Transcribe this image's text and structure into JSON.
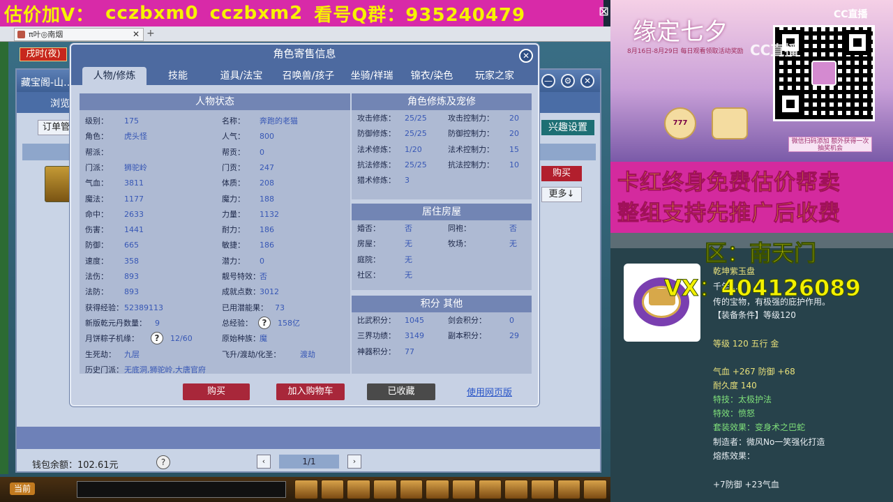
{
  "banner": {
    "segments": [
      "估价加V：",
      "cczbxm0",
      "cczbxm2",
      "看号Q群：935240479"
    ]
  },
  "browser": {
    "tab_title": "π叶◎南烟",
    "close": "✕",
    "new_tab": "+"
  },
  "hud": {
    "time": "戌时(夜)"
  },
  "store": {
    "title": "藏宝阁-山…",
    "browse": "浏览",
    "order": "订单管",
    "interest": "兴趣设置",
    "buy": "购买",
    "more": "更多↓",
    "wallet": "钱包余额：102.61元",
    "help": "?",
    "page": "1/1",
    "prev": "‹",
    "next": "›",
    "ctrl_min": "—",
    "ctrl_opt": "⚙",
    "ctrl_close": "✕"
  },
  "dialog": {
    "title": "角色寄售信息",
    "close": "✕",
    "tabs": [
      "人物/修炼",
      "技能",
      "道具/法宝",
      "召唤兽/孩子",
      "坐骑/祥瑞",
      "锦衣/染色",
      "玩家之家"
    ],
    "status_head": "人物状态",
    "status_left": [
      {
        "label": "级别：",
        "value": "175"
      },
      {
        "label": "角色：",
        "value": "虎头怪"
      },
      {
        "label": "帮派：",
        "value": ""
      },
      {
        "label": "门派：",
        "value": "狮驼岭"
      },
      {
        "label": "气血：",
        "value": "3811"
      },
      {
        "label": "魔法：",
        "value": "1177"
      },
      {
        "label": "命中：",
        "value": "2633"
      },
      {
        "label": "伤害：",
        "value": "1441"
      },
      {
        "label": "防御：",
        "value": "665"
      },
      {
        "label": "速度：",
        "value": "358"
      },
      {
        "label": "法伤：",
        "value": "893"
      },
      {
        "label": "法防：",
        "value": "893"
      },
      {
        "label": "获得经验：",
        "value": "52389113"
      },
      {
        "label": "新版乾元丹数量：",
        "value": "9"
      },
      {
        "label": "月饼粽子机缘：",
        "value": "12/60"
      },
      {
        "label": "生死劫：",
        "value": "九层"
      },
      {
        "label": "历史门派：",
        "value": "无底洞,狮驼岭,大唐官府"
      }
    ],
    "status_right": [
      {
        "label": "名称：",
        "value": "奔跑的老猫"
      },
      {
        "label": "人气：",
        "value": "800"
      },
      {
        "label": "帮贡：",
        "value": "0"
      },
      {
        "label": "门贡：",
        "value": "247"
      },
      {
        "label": "体质：",
        "value": "208"
      },
      {
        "label": "魔力：",
        "value": "188"
      },
      {
        "label": "力量：",
        "value": "1132"
      },
      {
        "label": "耐力：",
        "value": "186"
      },
      {
        "label": "敏捷：",
        "value": "186"
      },
      {
        "label": "潜力：",
        "value": "0"
      },
      {
        "label": "靓号特效：",
        "value": "否"
      },
      {
        "label": "成就点数：",
        "value": "3012"
      },
      {
        "label": "已用潜能果：",
        "value": "73"
      },
      {
        "label": "总经验：",
        "value": "158亿"
      },
      {
        "label": "原始种族：",
        "value": "魔"
      },
      {
        "label": "飞升/渡劫/化圣：",
        "value": "渡劫"
      }
    ],
    "cultivation_head": "角色修炼及宠修",
    "cultivation": [
      {
        "label": "攻击修炼：",
        "value": "25/25",
        "label2": "攻击控制力：",
        "value2": "20"
      },
      {
        "label": "防御修炼：",
        "value": "25/25",
        "label2": "防御控制力：",
        "value2": "20"
      },
      {
        "label": "法术修炼：",
        "value": "1/20",
        "label2": "法术控制力：",
        "value2": "15"
      },
      {
        "label": "抗法修炼：",
        "value": "25/25",
        "label2": "抗法控制力：",
        "value2": "10"
      },
      {
        "label": "猎术修炼：",
        "value": "3",
        "label2": "",
        "value2": ""
      }
    ],
    "house_head": "居住房屋",
    "house": [
      {
        "label": "婚否：",
        "value": "否",
        "label2": "同袍：",
        "value2": "否"
      },
      {
        "label": "房屋：",
        "value": "无",
        "label2": "牧场：",
        "value2": "无"
      },
      {
        "label": "庭院：",
        "value": "无",
        "label2": "",
        "value2": ""
      },
      {
        "label": "社区：",
        "value": "无",
        "label2": "",
        "value2": ""
      }
    ],
    "points_head": "积分 其他",
    "points": [
      {
        "label": "比武积分：",
        "value": "1045",
        "label2": "剑会积分：",
        "value2": "0"
      },
      {
        "label": "三界功绩：",
        "value": "3149",
        "label2": "副本积分：",
        "value2": "29"
      },
      {
        "label": "神器积分：",
        "value": "77",
        "label2": "",
        "value2": ""
      }
    ],
    "q": "?",
    "buttons": {
      "buy": "购买",
      "cart": "加入购物车",
      "saved": "已收藏",
      "web": "使用网页版"
    }
  },
  "promo": {
    "event_title": "缘定七夕",
    "event_date": "8月16日-8月29日 每日观看领取活动奖励",
    "cc_logo": "CC直播",
    "watermark": "CC直播",
    "badge": "777",
    "lottery": "微信扫码添加 额外获得一次抽奖机会",
    "line1": "卡红终身免费估价帮卖",
    "line2": "整组支持先推广后收费",
    "zone": "区：南天门",
    "vx": "VX：404126089"
  },
  "item": {
    "name": "乾坤紫玉盘",
    "desc1": "千年…",
    "desc2": "传的宝物，有极强的庇护作用。",
    "req": "【装备条件】等级120",
    "level": "等级 120  五行 金",
    "stats": "气血 +267 防御 +68",
    "durability": "耐久度 140",
    "skill": "特技：太极护法",
    "effect": "特效：愤怒",
    "set": "套装效果：变身术之巴蛇",
    "maker": "制造者：微风No一笑强化打造",
    "refine": "熔炼效果：",
    "refine_val": "+7防御 +23气血"
  },
  "colors": {
    "accent_blue": "#4d6aa0",
    "buy_red": "#a8273a",
    "banner_pink": "#d82aa8",
    "banner_yellow": "#f7f200"
  }
}
